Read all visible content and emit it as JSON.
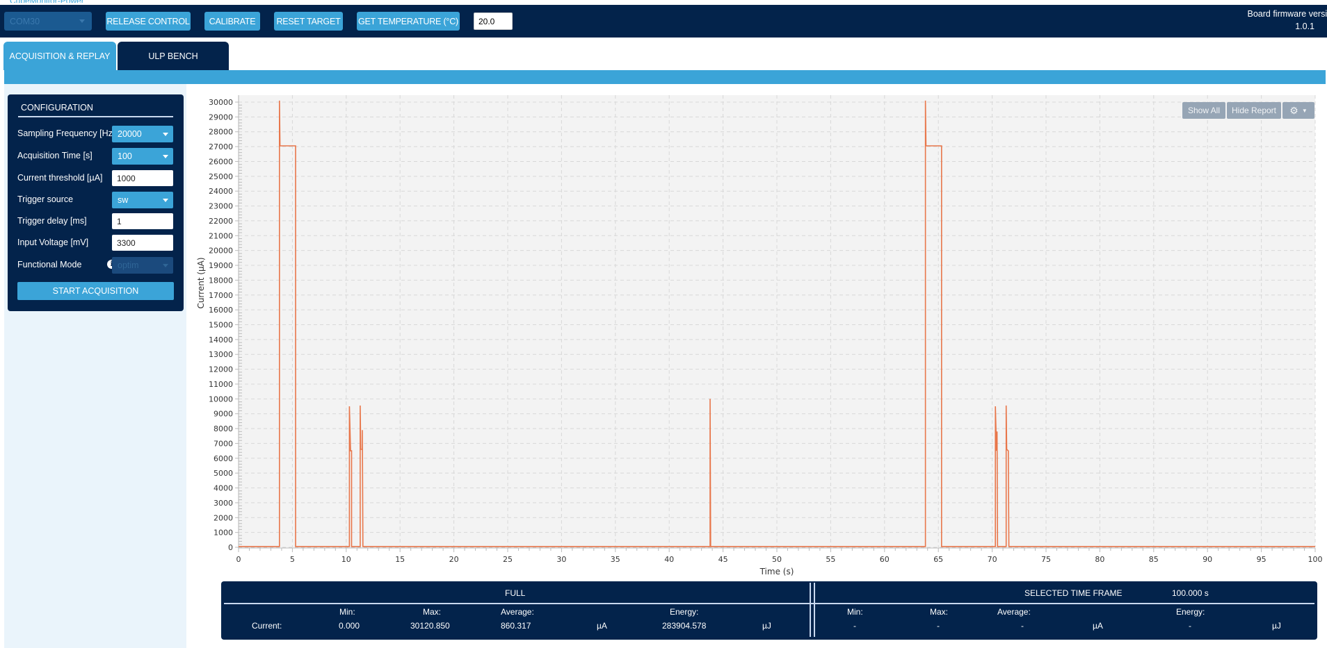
{
  "app": {
    "title": "CubeMonitor-Power"
  },
  "toolbar": {
    "port_select": "COM30",
    "release_control": "RELEASE CONTROL",
    "calibrate": "CALIBRATE",
    "reset_target": "RESET TARGET",
    "get_temperature": "GET TEMPERATURE (°C)",
    "temperature_value": "20.0",
    "firmware_label": "Board firmware version",
    "firmware_version": "1.0.1"
  },
  "tabs": [
    {
      "label": "ACQUISITION & REPLAY",
      "active": true
    },
    {
      "label": "ULP BENCH",
      "active": false
    }
  ],
  "config": {
    "title": "CONFIGURATION",
    "fields": [
      {
        "label": "Sampling Frequency [Hz]",
        "type": "select",
        "value": "20000"
      },
      {
        "label": "Acquisition Time [s]",
        "type": "select",
        "value": "100"
      },
      {
        "label": "Current threshold [µA]",
        "type": "input",
        "value": "1000"
      },
      {
        "label": "Trigger source",
        "type": "select",
        "value": "sw"
      },
      {
        "label": "Trigger delay [ms]",
        "type": "input",
        "value": "1"
      },
      {
        "label": "Input Voltage [mV]",
        "type": "input",
        "value": "3300"
      },
      {
        "label": "Functional Mode",
        "type": "select",
        "value": "optim",
        "disabled": true
      }
    ],
    "start_button": "START ACQUISITION"
  },
  "chart_tools": {
    "show_all": "Show All",
    "hide_report": "Hide Report"
  },
  "chart_data": {
    "type": "line",
    "title": "",
    "xlabel": "Time (s)",
    "ylabel": "Current (µA)",
    "xlim": [
      0,
      100
    ],
    "ylim": [
      0,
      30000
    ],
    "xticks": [
      0,
      5,
      10,
      15,
      20,
      25,
      30,
      35,
      40,
      45,
      50,
      55,
      60,
      65,
      70,
      75,
      80,
      85,
      90,
      95,
      100
    ],
    "yticks": [
      0,
      1000,
      2000,
      3000,
      4000,
      5000,
      6000,
      7000,
      8000,
      9000,
      10000,
      11000,
      12000,
      13000,
      14000,
      15000,
      16000,
      17000,
      18000,
      19000,
      20000,
      21000,
      22000,
      23000,
      24000,
      25000,
      26000,
      27000,
      28000,
      29000,
      30000
    ],
    "grid": true,
    "line_color": "#e8764a",
    "series": [
      {
        "name": "Current",
        "points": [
          [
            0,
            50
          ],
          [
            3.8,
            50
          ],
          [
            3.8,
            30100
          ],
          [
            3.85,
            27050
          ],
          [
            5.3,
            27050
          ],
          [
            5.3,
            50
          ],
          [
            10.3,
            50
          ],
          [
            10.3,
            9500
          ],
          [
            10.4,
            6500
          ],
          [
            10.5,
            6500
          ],
          [
            10.5,
            50
          ],
          [
            11.3,
            50
          ],
          [
            11.3,
            9550
          ],
          [
            11.35,
            6600
          ],
          [
            11.5,
            6600
          ],
          [
            11.5,
            7900
          ],
          [
            11.55,
            50
          ],
          [
            43.8,
            50
          ],
          [
            43.8,
            10000
          ],
          [
            43.85,
            50
          ],
          [
            63.8,
            50
          ],
          [
            63.8,
            30100
          ],
          [
            63.85,
            27050
          ],
          [
            65.3,
            27050
          ],
          [
            65.3,
            50
          ],
          [
            70.3,
            50
          ],
          [
            70.3,
            9500
          ],
          [
            70.4,
            6500
          ],
          [
            70.45,
            7800
          ],
          [
            70.5,
            50
          ],
          [
            71.3,
            50
          ],
          [
            71.3,
            9550
          ],
          [
            71.35,
            6600
          ],
          [
            71.5,
            6500
          ],
          [
            71.55,
            50
          ],
          [
            100,
            50
          ]
        ]
      }
    ]
  },
  "report": {
    "full_title": "FULL",
    "selected_title": "SELECTED TIME FRAME",
    "selected_duration": "100.000 s",
    "row_label": "Current:",
    "headers": {
      "min": "Min:",
      "max": "Max:",
      "average": "Average:",
      "energy": "Energy:"
    },
    "full": {
      "min": "0.000",
      "max": "30120.850",
      "average": "860.317",
      "current_unit": "µA",
      "energy": "283904.578",
      "energy_unit": "µJ"
    },
    "selected": {
      "min": "-",
      "max": "-",
      "average": "-",
      "current_unit": "µA",
      "energy": "-",
      "energy_unit": "µJ"
    }
  }
}
